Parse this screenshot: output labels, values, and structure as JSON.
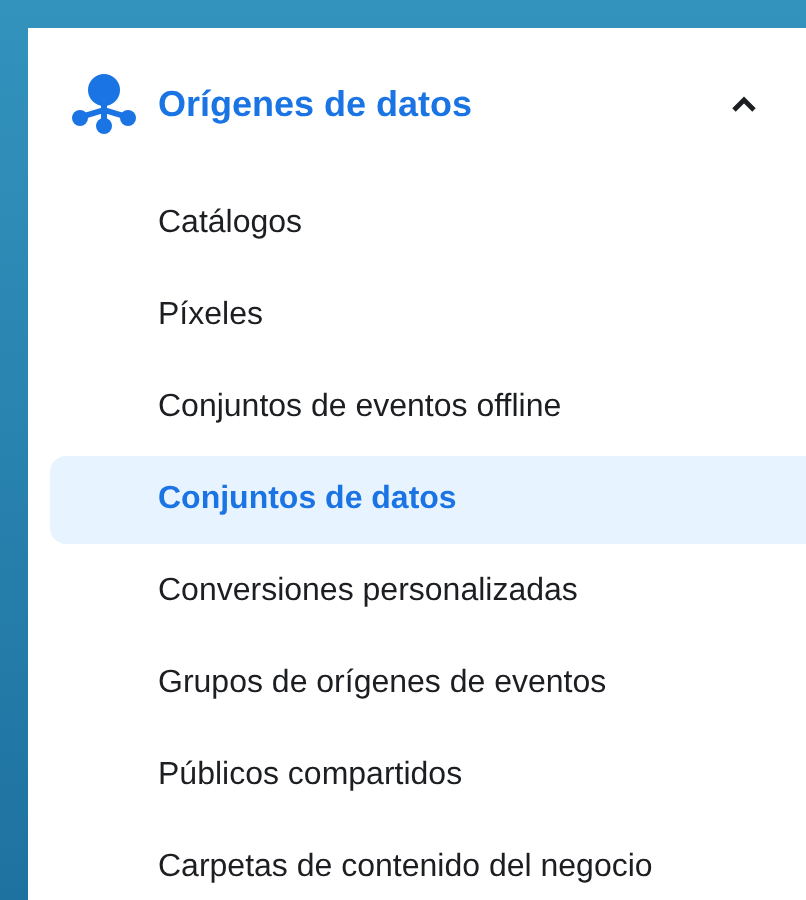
{
  "section": {
    "title": "Orígenes de datos",
    "expanded": true
  },
  "items": [
    {
      "label": "Catálogos",
      "selected": false
    },
    {
      "label": "Píxeles",
      "selected": false
    },
    {
      "label": "Conjuntos de eventos offline",
      "selected": false
    },
    {
      "label": "Conjuntos de datos",
      "selected": true
    },
    {
      "label": "Conversiones personalizadas",
      "selected": false
    },
    {
      "label": "Grupos de orígenes de eventos",
      "selected": false
    },
    {
      "label": "Públicos compartidos",
      "selected": false
    },
    {
      "label": "Carpetas de contenido del negocio",
      "selected": false
    }
  ]
}
